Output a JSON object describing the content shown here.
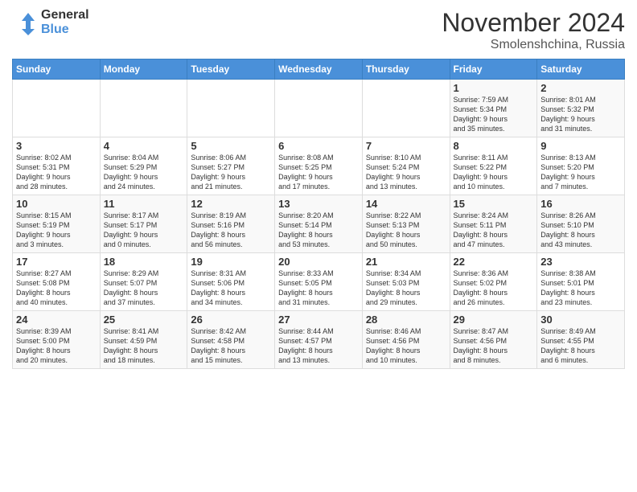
{
  "header": {
    "logo_line1": "General",
    "logo_line2": "Blue",
    "month_title": "November 2024",
    "location": "Smolenshchina, Russia"
  },
  "weekdays": [
    "Sunday",
    "Monday",
    "Tuesday",
    "Wednesday",
    "Thursday",
    "Friday",
    "Saturday"
  ],
  "weeks": [
    [
      {
        "day": "",
        "info": ""
      },
      {
        "day": "",
        "info": ""
      },
      {
        "day": "",
        "info": ""
      },
      {
        "day": "",
        "info": ""
      },
      {
        "day": "",
        "info": ""
      },
      {
        "day": "1",
        "info": "Sunrise: 7:59 AM\nSunset: 5:34 PM\nDaylight: 9 hours\nand 35 minutes."
      },
      {
        "day": "2",
        "info": "Sunrise: 8:01 AM\nSunset: 5:32 PM\nDaylight: 9 hours\nand 31 minutes."
      }
    ],
    [
      {
        "day": "3",
        "info": "Sunrise: 8:02 AM\nSunset: 5:31 PM\nDaylight: 9 hours\nand 28 minutes."
      },
      {
        "day": "4",
        "info": "Sunrise: 8:04 AM\nSunset: 5:29 PM\nDaylight: 9 hours\nand 24 minutes."
      },
      {
        "day": "5",
        "info": "Sunrise: 8:06 AM\nSunset: 5:27 PM\nDaylight: 9 hours\nand 21 minutes."
      },
      {
        "day": "6",
        "info": "Sunrise: 8:08 AM\nSunset: 5:25 PM\nDaylight: 9 hours\nand 17 minutes."
      },
      {
        "day": "7",
        "info": "Sunrise: 8:10 AM\nSunset: 5:24 PM\nDaylight: 9 hours\nand 13 minutes."
      },
      {
        "day": "8",
        "info": "Sunrise: 8:11 AM\nSunset: 5:22 PM\nDaylight: 9 hours\nand 10 minutes."
      },
      {
        "day": "9",
        "info": "Sunrise: 8:13 AM\nSunset: 5:20 PM\nDaylight: 9 hours\nand 7 minutes."
      }
    ],
    [
      {
        "day": "10",
        "info": "Sunrise: 8:15 AM\nSunset: 5:19 PM\nDaylight: 9 hours\nand 3 minutes."
      },
      {
        "day": "11",
        "info": "Sunrise: 8:17 AM\nSunset: 5:17 PM\nDaylight: 9 hours\nand 0 minutes."
      },
      {
        "day": "12",
        "info": "Sunrise: 8:19 AM\nSunset: 5:16 PM\nDaylight: 8 hours\nand 56 minutes."
      },
      {
        "day": "13",
        "info": "Sunrise: 8:20 AM\nSunset: 5:14 PM\nDaylight: 8 hours\nand 53 minutes."
      },
      {
        "day": "14",
        "info": "Sunrise: 8:22 AM\nSunset: 5:13 PM\nDaylight: 8 hours\nand 50 minutes."
      },
      {
        "day": "15",
        "info": "Sunrise: 8:24 AM\nSunset: 5:11 PM\nDaylight: 8 hours\nand 47 minutes."
      },
      {
        "day": "16",
        "info": "Sunrise: 8:26 AM\nSunset: 5:10 PM\nDaylight: 8 hours\nand 43 minutes."
      }
    ],
    [
      {
        "day": "17",
        "info": "Sunrise: 8:27 AM\nSunset: 5:08 PM\nDaylight: 8 hours\nand 40 minutes."
      },
      {
        "day": "18",
        "info": "Sunrise: 8:29 AM\nSunset: 5:07 PM\nDaylight: 8 hours\nand 37 minutes."
      },
      {
        "day": "19",
        "info": "Sunrise: 8:31 AM\nSunset: 5:06 PM\nDaylight: 8 hours\nand 34 minutes."
      },
      {
        "day": "20",
        "info": "Sunrise: 8:33 AM\nSunset: 5:05 PM\nDaylight: 8 hours\nand 31 minutes."
      },
      {
        "day": "21",
        "info": "Sunrise: 8:34 AM\nSunset: 5:03 PM\nDaylight: 8 hours\nand 29 minutes."
      },
      {
        "day": "22",
        "info": "Sunrise: 8:36 AM\nSunset: 5:02 PM\nDaylight: 8 hours\nand 26 minutes."
      },
      {
        "day": "23",
        "info": "Sunrise: 8:38 AM\nSunset: 5:01 PM\nDaylight: 8 hours\nand 23 minutes."
      }
    ],
    [
      {
        "day": "24",
        "info": "Sunrise: 8:39 AM\nSunset: 5:00 PM\nDaylight: 8 hours\nand 20 minutes."
      },
      {
        "day": "25",
        "info": "Sunrise: 8:41 AM\nSunset: 4:59 PM\nDaylight: 8 hours\nand 18 minutes."
      },
      {
        "day": "26",
        "info": "Sunrise: 8:42 AM\nSunset: 4:58 PM\nDaylight: 8 hours\nand 15 minutes."
      },
      {
        "day": "27",
        "info": "Sunrise: 8:44 AM\nSunset: 4:57 PM\nDaylight: 8 hours\nand 13 minutes."
      },
      {
        "day": "28",
        "info": "Sunrise: 8:46 AM\nSunset: 4:56 PM\nDaylight: 8 hours\nand 10 minutes."
      },
      {
        "day": "29",
        "info": "Sunrise: 8:47 AM\nSunset: 4:56 PM\nDaylight: 8 hours\nand 8 minutes."
      },
      {
        "day": "30",
        "info": "Sunrise: 8:49 AM\nSunset: 4:55 PM\nDaylight: 8 hours\nand 6 minutes."
      }
    ]
  ]
}
